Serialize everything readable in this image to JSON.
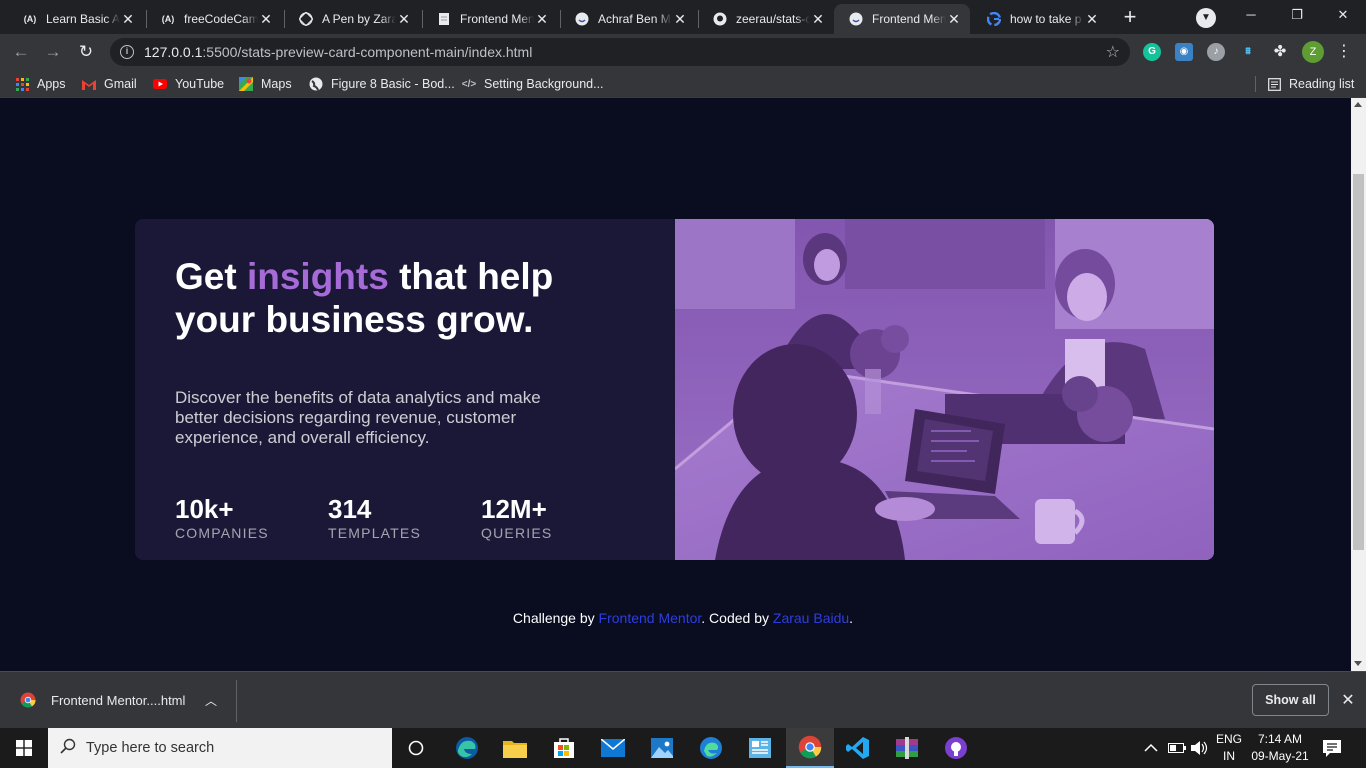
{
  "browser": {
    "tabs": [
      {
        "title": "Learn Basic AI",
        "favicon": "A"
      },
      {
        "title": "freeCodeCamp",
        "favicon": "A"
      },
      {
        "title": "A Pen by Zara",
        "favicon": "codepen"
      },
      {
        "title": "Frontend Mentor",
        "favicon": "doc"
      },
      {
        "title": "Achraf Ben M",
        "favicon": "circle"
      },
      {
        "title": "zeerau/stats-c",
        "favicon": "github"
      },
      {
        "title": "Frontend Mentor",
        "favicon": "circle",
        "active": true
      },
      {
        "title": "how to take p",
        "favicon": "google"
      }
    ],
    "url_host": "127.0.0.1",
    "url_path": ":5500/stats-preview-card-component-main/index.html",
    "profile_initial": "Z",
    "bookmarks": [
      {
        "label": "Apps"
      },
      {
        "label": "Gmail"
      },
      {
        "label": "YouTube"
      },
      {
        "label": "Maps"
      },
      {
        "label": "Figure 8 Basic - Bod..."
      },
      {
        "label": "Setting Background..."
      }
    ],
    "reading_list": "Reading list"
  },
  "card": {
    "headline_pre": "Get ",
    "headline_accent": "insights",
    "headline_post": " that help your business grow.",
    "description": "Discover the benefits of data analytics and make better decisions regarding revenue, customer experience, and overall efficiency.",
    "stats": [
      {
        "value": "10k+",
        "label": "COMPANIES"
      },
      {
        "value": "314",
        "label": "TEMPLATES"
      },
      {
        "value": "12M+",
        "label": "QUERIES"
      }
    ],
    "accent_color": "#a66bd6",
    "card_bg": "#1b1837",
    "image_tint": "#8a62b5"
  },
  "attribution": {
    "pre": "Challenge by ",
    "link1": "Frontend Mentor",
    "mid": ". Coded by ",
    "link2": "Zarau Baidu",
    "post": "."
  },
  "downloads": {
    "file": "Frontend Mentor....html",
    "show_all": "Show all"
  },
  "taskbar": {
    "search_placeholder": "Type here to search",
    "lang_top": "ENG",
    "lang_bottom": "IN",
    "time": "7:14 AM",
    "date": "09-May-21"
  }
}
